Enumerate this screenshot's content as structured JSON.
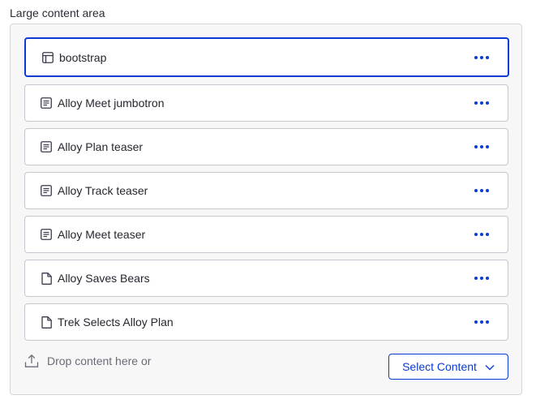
{
  "section": {
    "label": "Large content area"
  },
  "items": [
    {
      "label": "bootstrap",
      "icon": "layout-icon",
      "selected": true
    },
    {
      "label": "Alloy Meet jumbotron",
      "icon": "block-icon"
    },
    {
      "label": "Alloy Plan teaser",
      "icon": "block-icon"
    },
    {
      "label": "Alloy Track teaser",
      "icon": "block-icon"
    },
    {
      "label": "Alloy Meet teaser",
      "icon": "block-icon"
    },
    {
      "label": "Alloy Saves Bears",
      "icon": "page-icon"
    },
    {
      "label": "Trek Selects Alloy Plan",
      "icon": "page-icon"
    }
  ],
  "drop": {
    "text": "Drop content here or"
  },
  "select_button": {
    "label": "Select Content"
  },
  "colors": {
    "accent": "#0a3bd4",
    "icon": "#3a3a4a",
    "area_bg": "#f7f7f8"
  }
}
